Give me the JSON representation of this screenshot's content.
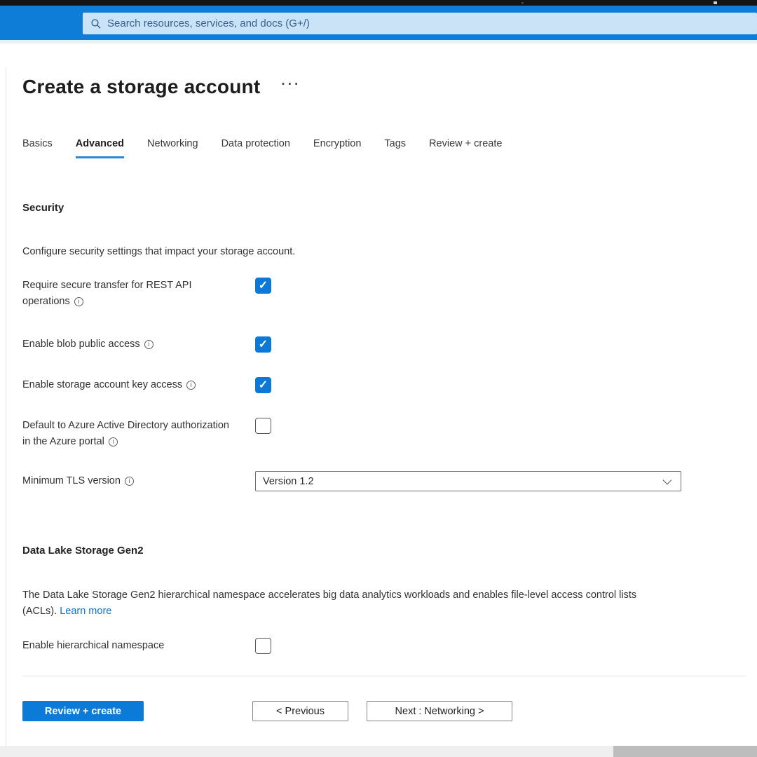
{
  "topbar": {
    "search_placeholder": "Search resources, services, and docs (G+/)"
  },
  "page": {
    "title": "Create a storage account",
    "title_menu": "···"
  },
  "tabs": [
    {
      "label": "Basics",
      "active": false
    },
    {
      "label": "Advanced",
      "active": true
    },
    {
      "label": "Networking",
      "active": false
    },
    {
      "label": "Data protection",
      "active": false
    },
    {
      "label": "Encryption",
      "active": false
    },
    {
      "label": "Tags",
      "active": false
    },
    {
      "label": "Review + create",
      "active": false
    }
  ],
  "security": {
    "heading": "Security",
    "description": "Configure security settings that impact your storage account.",
    "rows": [
      {
        "label": "Require secure transfer for REST API operations",
        "checked": true
      },
      {
        "label": "Enable blob public access",
        "checked": true
      },
      {
        "label": "Enable storage account key access",
        "checked": true
      },
      {
        "label": "Default to Azure Active Directory authorization in the Azure portal",
        "checked": false
      }
    ],
    "tls": {
      "label": "Minimum TLS version",
      "value": "Version 1.2"
    }
  },
  "data_lake": {
    "heading": "Data Lake Storage Gen2",
    "description": "The Data Lake Storage Gen2 hierarchical namespace accelerates big data analytics workloads and enables file-level access control lists (ACLs).",
    "link_label": "Learn more",
    "rows": [
      {
        "label": "Enable hierarchical namespace",
        "checked": false
      }
    ]
  },
  "footer": {
    "review_create": "Review + create",
    "previous": "< Previous",
    "next": "Next : Networking >"
  },
  "colors": {
    "topbar_blue": "#0d7dd8",
    "checkbox_blue": "#0c79d6",
    "primary_button": "#0c7bd7",
    "link": "#0b72c9",
    "tab_underline": "#2a86d8"
  }
}
